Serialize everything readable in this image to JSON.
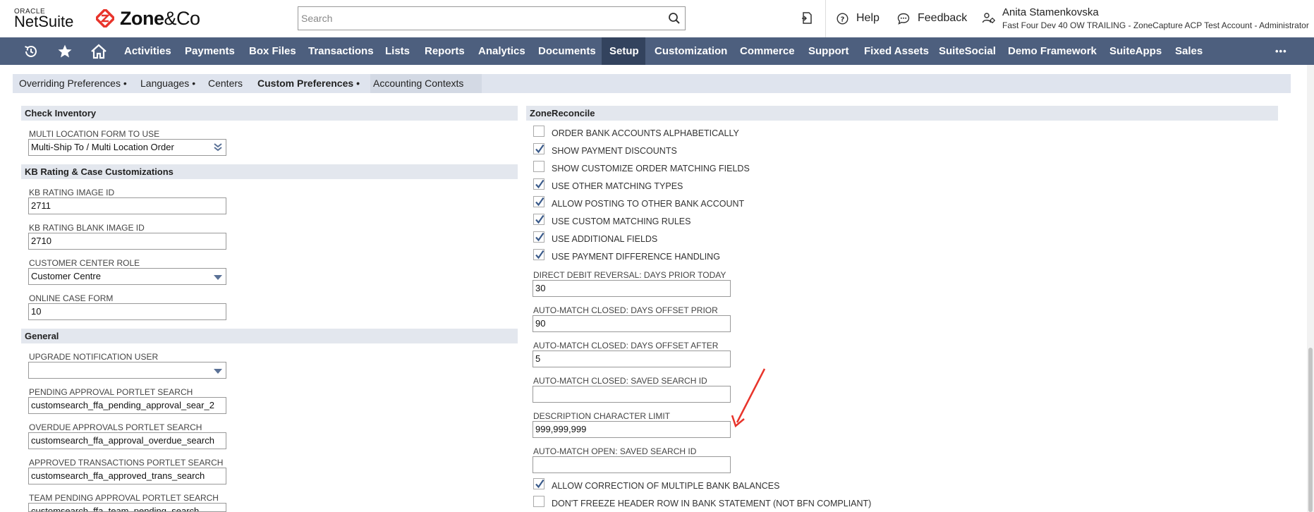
{
  "brand": {
    "oracle": "ORACLE",
    "netsuite": "NetSuite",
    "zone_prefix": "Zone",
    "zone_amp": "&",
    "zone_suffix": "Co"
  },
  "search": {
    "placeholder": "Search"
  },
  "header": {
    "help": "Help",
    "feedback": "Feedback",
    "user_name": "Anita Stamenkovska",
    "user_sub": "Fast Four Dev 40 OW TRAILING - ZoneCapture ACP Test Account - Administrator"
  },
  "nav": {
    "items": [
      "Activities",
      "Payments",
      "Box Files",
      "Transactions",
      "Lists",
      "Reports",
      "Analytics",
      "Documents",
      "Setup",
      "Customization",
      "Commerce",
      "Support",
      "Fixed Assets",
      "SuiteSocial",
      "Demo Framework",
      "SuiteApps",
      "Sales"
    ],
    "active": "Setup",
    "more": "•••"
  },
  "subnav": {
    "items": [
      "Overriding Preferences",
      "Languages",
      "Centers",
      "Custom Preferences",
      "Accounting Contexts"
    ],
    "bullet": "•"
  },
  "left": {
    "check_inventory": {
      "title": "Check Inventory",
      "multi_location_label": "MULTI LOCATION FORM TO USE",
      "multi_location_value": "Multi-Ship To / Multi Location Order"
    },
    "kb": {
      "title": "KB Rating & Case Customizations",
      "rating_image_label": "KB RATING IMAGE ID",
      "rating_image_value": "2711",
      "rating_blank_label": "KB RATING BLANK IMAGE ID",
      "rating_blank_value": "2710",
      "center_role_label": "CUSTOMER CENTER ROLE",
      "center_role_value": "Customer Centre",
      "case_form_label": "ONLINE CASE FORM",
      "case_form_value": "10"
    },
    "general": {
      "title": "General",
      "upgrade_label": "UPGRADE NOTIFICATION USER",
      "upgrade_value": "",
      "pending_label": "PENDING APPROVAL PORTLET SEARCH",
      "pending_value": "customsearch_ffa_pending_approval_sear_2",
      "overdue_label": "OVERDUE APPROVALS PORTLET SEARCH",
      "overdue_value": "customsearch_ffa_approval_overdue_search",
      "approved_label": "APPROVED TRANSACTIONS PORTLET SEARCH",
      "approved_value": "customsearch_ffa_approved_trans_search",
      "team_label": "TEAM PENDING APPROVAL PORTLET SEARCH",
      "team_value": "customsearch_ffa_team_pending_search"
    }
  },
  "right": {
    "title": "ZoneReconcile",
    "checkboxes": [
      {
        "label": "ORDER BANK ACCOUNTS ALPHABETICALLY",
        "checked": false
      },
      {
        "label": "SHOW PAYMENT DISCOUNTS",
        "checked": true
      },
      {
        "label": "SHOW CUSTOMIZE ORDER MATCHING FIELDS",
        "checked": false
      },
      {
        "label": "USE OTHER MATCHING TYPES",
        "checked": true
      },
      {
        "label": "ALLOW POSTING TO OTHER BANK ACCOUNT",
        "checked": true
      },
      {
        "label": "USE CUSTOM MATCHING RULES",
        "checked": true
      },
      {
        "label": "USE ADDITIONAL FIELDS",
        "checked": true
      },
      {
        "label": "USE PAYMENT DIFFERENCE HANDLING",
        "checked": true
      }
    ],
    "dd_reversal_label": "DIRECT DEBIT REVERSAL: DAYS PRIOR TODAY",
    "dd_reversal_value": "30",
    "offset_prior_label": "AUTO-MATCH CLOSED: DAYS OFFSET PRIOR",
    "offset_prior_value": "90",
    "offset_after_label": "AUTO-MATCH CLOSED: DAYS OFFSET AFTER",
    "offset_after_value": "5",
    "closed_saved_label": "AUTO-MATCH CLOSED: SAVED SEARCH ID",
    "closed_saved_value": "",
    "desc_limit_label": "DESCRIPTION CHARACTER LIMIT",
    "desc_limit_value": "999,999,999",
    "open_saved_label": "AUTO-MATCH OPEN: SAVED SEARCH ID",
    "open_saved_value": "",
    "bottom_checkboxes": [
      {
        "label": "ALLOW CORRECTION OF MULTIPLE BANK BALANCES",
        "checked": true
      },
      {
        "label": "DON'T FREEZE HEADER ROW IN BANK STATEMENT (NOT BFN COMPLIANT)",
        "checked": false
      }
    ]
  },
  "colors": {
    "nav_bg": "#4d5f7e",
    "nav_active": "#33435e",
    "section_bg": "#e3e7ee",
    "annotation_arrow": "#e8342b",
    "zone_red": "#e8342b"
  }
}
